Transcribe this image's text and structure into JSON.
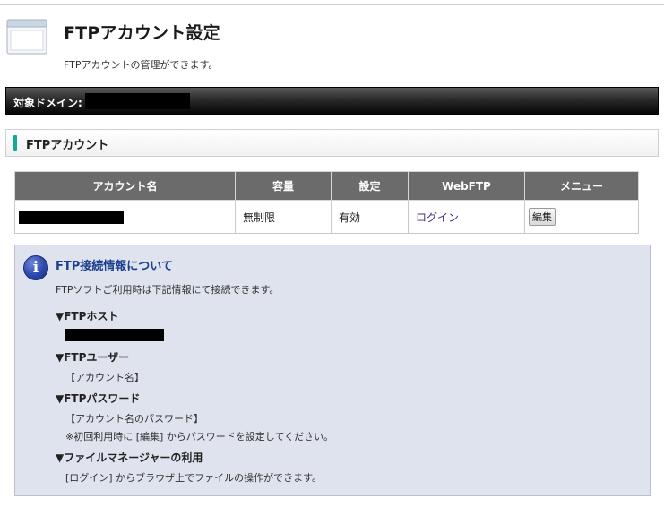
{
  "header": {
    "title": "FTPアカウント設定",
    "subtitle": "FTPアカウントの管理ができます。",
    "icon": "window-icon"
  },
  "domain_bar": {
    "label": "対象ドメイン:",
    "value_redacted": true
  },
  "section": {
    "title": "FTPアカウント",
    "accent_color": "#14a89a"
  },
  "table": {
    "headers": [
      "アカウント名",
      "容量",
      "設定",
      "WebFTP",
      "メニュー"
    ],
    "rows": [
      {
        "account_redacted": true,
        "capacity": "無制限",
        "setting": "有効",
        "webftp_link": "ログイン",
        "menu_button": "編集"
      }
    ]
  },
  "info": {
    "icon": "info-icon",
    "title": "FTP接続情報について",
    "intro": "FTPソフトご利用時は下記情報にて接続できます。",
    "host_heading": "▼FTPホスト",
    "user_heading": "▼FTPユーザー",
    "user_value": "【アカウント名】",
    "password_heading": "▼FTPパスワード",
    "password_value": "【アカウント名のパスワード】",
    "password_note": "※初回利用時に [編集] からパスワードを設定してください。",
    "filemanager_heading": "▼ファイルマネージャーの利用",
    "filemanager_text": "[ログイン] からブラウザ上でファイルの操作ができます。"
  },
  "colors": {
    "header_bar": "#000000",
    "table_header": "#6b6b6b",
    "info_bg": "#dfe3ed",
    "info_title": "#1b3f8f",
    "link": "#4b2a8a"
  }
}
